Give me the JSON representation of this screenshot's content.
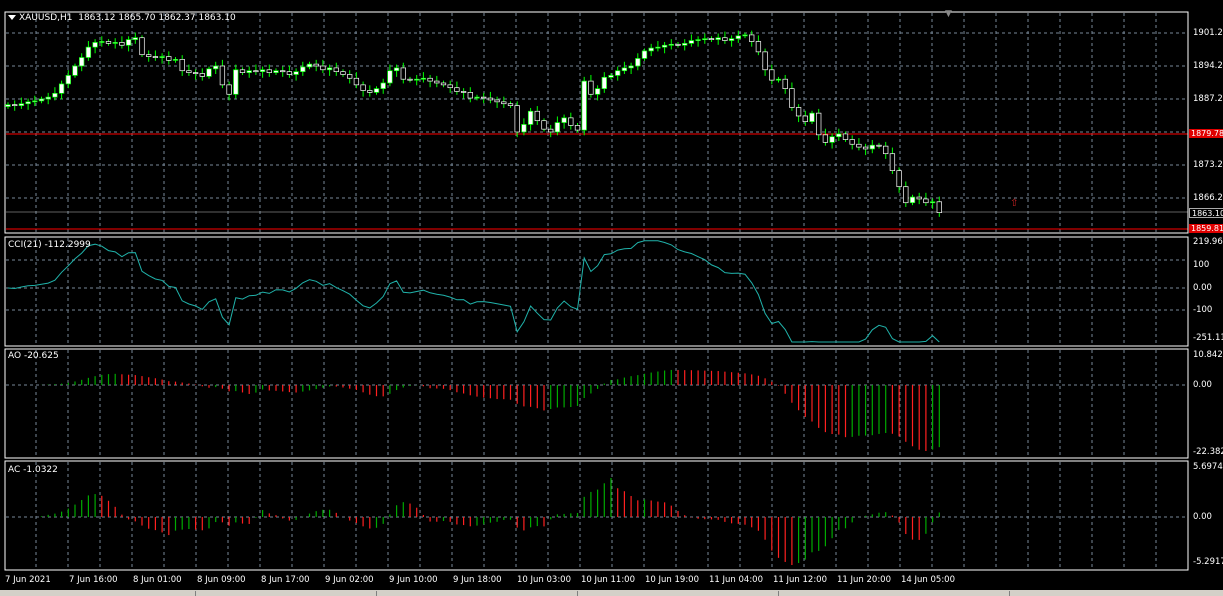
{
  "chart_header": {
    "symbol_label": "XAUUSD,H1",
    "ohlc": "1863.12 1865.70 1862.37 1863.10"
  },
  "price_axis": {
    "labels": [
      "1901.20",
      "1894.20",
      "1887.20",
      "1873.20",
      "1866.20"
    ],
    "level_line_1": "1879.78",
    "current_price": "1863.10",
    "level_line_2": "1859.81"
  },
  "cci": {
    "label": "CCI(21) -112.2999",
    "axis": [
      "219.966",
      "100",
      "0.00",
      "-100",
      "-251.11"
    ]
  },
  "ao": {
    "label": "AO -20.625",
    "axis": [
      "10.842",
      "0.00",
      "-22.382"
    ]
  },
  "ac": {
    "label": "AC -1.0322",
    "axis": [
      "5.6974",
      "0.00",
      "-5.2917"
    ]
  },
  "time_axis": [
    "7 Jun 2021",
    "7 Jun 16:00",
    "8 Jun 01:00",
    "8 Jun 09:00",
    "8 Jun 17:00",
    "9 Jun 02:00",
    "9 Jun 10:00",
    "9 Jun 18:00",
    "10 Jun 03:00",
    "10 Jun 11:00",
    "10 Jun 19:00",
    "11 Jun 04:00",
    "11 Jun 12:00",
    "11 Jun 20:00",
    "14 Jun 05:00"
  ],
  "colors": {
    "background": "#000000",
    "grid": "#778899",
    "bull_candle": "#ffffff",
    "wick": "#00ff00",
    "level_line": "#ff0000",
    "cci_line": "#20b2aa",
    "ao_up": "#00aa00",
    "ao_down": "#ff2020"
  },
  "chart_data": {
    "type": "candlestick",
    "symbol": "XAUUSD",
    "timeframe": "H1",
    "close": [
      1886.0,
      1885.8,
      1886.2,
      1886.6,
      1886.8,
      1887.2,
      1887.6,
      1888.4,
      1890.4,
      1892.2,
      1894.2,
      1896.0,
      1898.2,
      1899.2,
      1899.4,
      1899.0,
      1899.2,
      1898.6,
      1899.8,
      1900.2,
      1896.6,
      1896.2,
      1896.0,
      1896.2,
      1895.4,
      1895.6,
      1893.2,
      1892.8,
      1892.6,
      1892.0,
      1893.6,
      1894.2,
      1890.2,
      1888.2,
      1893.4,
      1892.8,
      1893.2,
      1893.0,
      1893.4,
      1892.8,
      1893.2,
      1893.0,
      1892.4,
      1893.0,
      1894.0,
      1894.6,
      1894.2,
      1893.4,
      1893.8,
      1893.0,
      1892.4,
      1891.6,
      1890.2,
      1889.0,
      1888.6,
      1889.4,
      1890.6,
      1893.2,
      1893.8,
      1891.4,
      1891.2,
      1891.4,
      1891.6,
      1891.0,
      1890.6,
      1890.2,
      1889.6,
      1888.8,
      1888.6,
      1887.4,
      1887.6,
      1887.4,
      1887.0,
      1886.6,
      1886.2,
      1885.8,
      1880.2,
      1881.8,
      1884.6,
      1882.6,
      1880.8,
      1880.2,
      1882.2,
      1883.2,
      1881.6,
      1880.6,
      1891.0,
      1888.2,
      1889.4,
      1891.8,
      1892.2,
      1893.2,
      1893.8,
      1894.2,
      1895.8,
      1897.4,
      1898.0,
      1898.2,
      1898.6,
      1898.8,
      1898.6,
      1899.0,
      1899.6,
      1899.8,
      1900.0,
      1899.8,
      1900.2,
      1899.6,
      1900.0,
      1900.6,
      1900.8,
      1899.4,
      1897.2,
      1893.4,
      1891.2,
      1891.4,
      1889.4,
      1885.4,
      1883.6,
      1882.4,
      1884.2,
      1879.6,
      1878.0,
      1879.2,
      1879.8,
      1878.6,
      1877.6,
      1877.0,
      1876.6,
      1877.4,
      1877.2,
      1875.6,
      1872.0,
      1868.6,
      1865.2,
      1866.4,
      1866.0,
      1865.2,
      1865.4,
      1863.1
    ]
  }
}
